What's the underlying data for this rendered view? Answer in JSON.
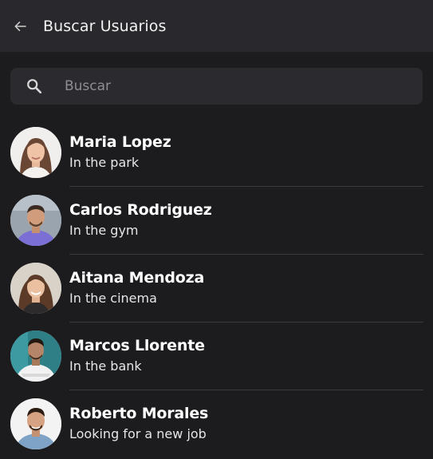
{
  "appbar": {
    "back_icon": "arrow-left-icon",
    "title": "Buscar Usuarios"
  },
  "search": {
    "icon": "search-icon",
    "placeholder": "Buscar",
    "value": ""
  },
  "users": [
    {
      "name": "Maria Lopez",
      "status": "In the park"
    },
    {
      "name": "Carlos Rodriguez",
      "status": "In the gym"
    },
    {
      "name": "Aitana Mendoza",
      "status": "In the cinema"
    },
    {
      "name": "Marcos Llorente",
      "status": "In the bank"
    },
    {
      "name": "Roberto Morales",
      "status": "Looking for a new job"
    }
  ],
  "colors": {
    "background": "#1c1b1e",
    "appbar": "#29282c",
    "search_field": "#2b2a2e",
    "divider": "#3b3a3f"
  }
}
